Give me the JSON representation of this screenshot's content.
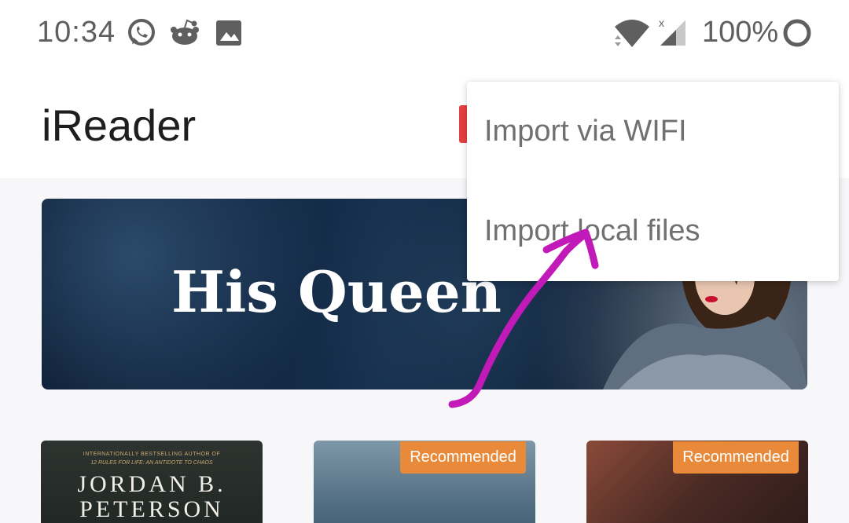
{
  "status_bar": {
    "time": "10:34",
    "battery": "100%",
    "icons": [
      "whatsapp-icon",
      "reddit-icon",
      "image-icon",
      "wifi-icon",
      "cell-signal-icon",
      "battery-ring-icon"
    ]
  },
  "app_bar": {
    "title": "iReader"
  },
  "banner": {
    "title": "His Queen"
  },
  "menu": {
    "items": [
      {
        "label": "Import via WIFI"
      },
      {
        "label": "Import local files"
      }
    ]
  },
  "books": [
    {
      "subtitle": "INTERNATIONALLY BESTSELLING AUTHOR OF",
      "subtitle2": "12 RULES FOR LIFE: AN ANTIDOTE TO CHAOS",
      "author_line1": "JORDAN B.",
      "author_line2": "PETERSON",
      "badge": ""
    },
    {
      "badge": "Recommended"
    },
    {
      "badge": "Recommended"
    }
  ],
  "colors": {
    "badge": "#e88a3a",
    "annotation": "#c21ab8",
    "menu_text": "#707070"
  }
}
